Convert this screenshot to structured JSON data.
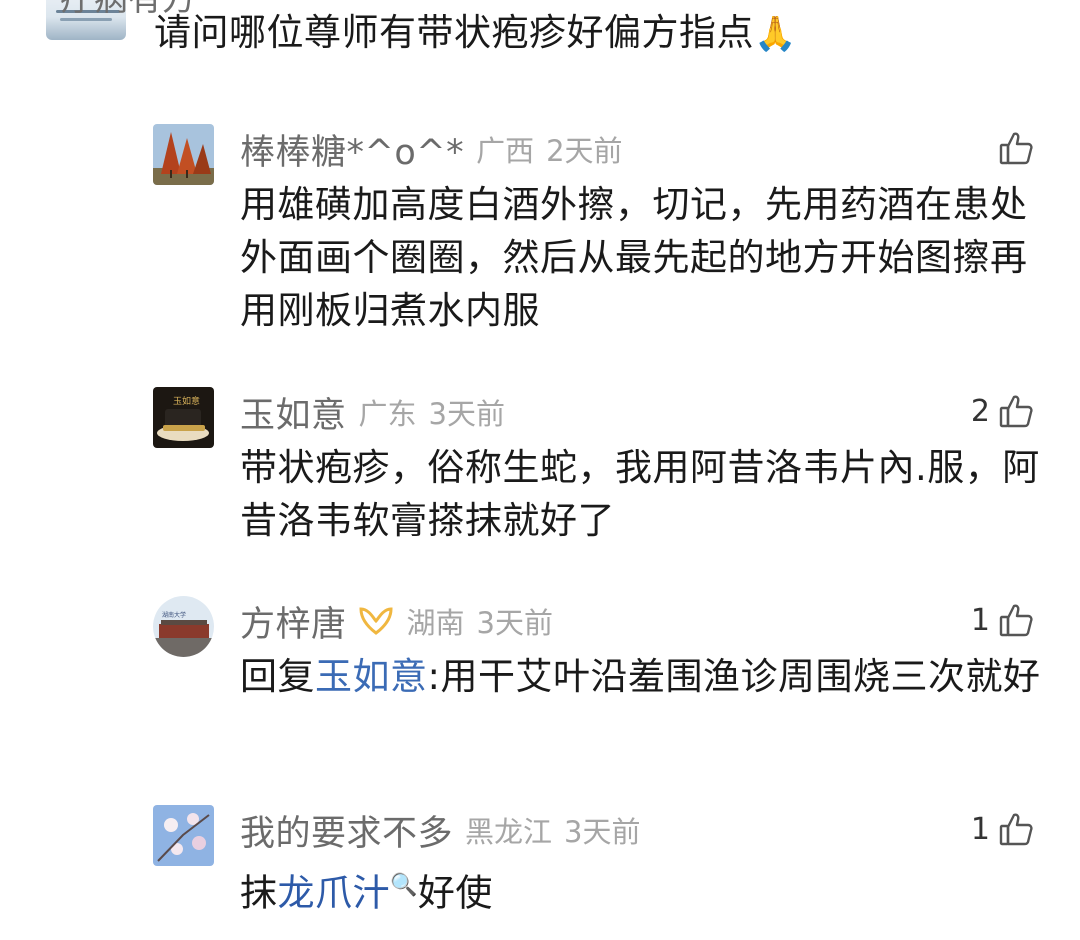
{
  "parent": {
    "username": "疗病有方",
    "text": "请问哪位尊师有带状疱疹好偏方指点",
    "emoji": "🙏"
  },
  "replies": [
    {
      "name": "棒棒糖*^o^*",
      "region": "广西",
      "time": "2天前",
      "likes": "",
      "body": "用雄磺加高度白酒外擦，切记，先用药酒在患处外面画个圈圈，然后从最先起的地方开始图擦再用刚板归煮水内服"
    },
    {
      "name": "玉如意",
      "region": "广东",
      "time": "3天前",
      "likes": "2",
      "body": "带状疱疹，俗称生蛇，我用阿昔洛韦片內.服，阿昔洛韦软膏搽抹就好了"
    },
    {
      "name": "方梓唐",
      "region": "湖南",
      "time": "3天前",
      "likes": "1",
      "body_prefix": "回复",
      "mention": "玉如意",
      "body": ":用干艾叶沿羞围渔诊周围烧三次就好"
    },
    {
      "name": "我的要求不多",
      "region": "黑龙江",
      "time": "3天前",
      "likes": "1",
      "body_prefix": "抹",
      "link_text": "龙爪汁",
      "link_icon": "🔍",
      "body": "好使"
    }
  ],
  "icons": {
    "like": "thumbs-up-icon",
    "vip": "vip-badge-icon"
  },
  "colors": {
    "name": "#6b6b6b",
    "meta": "#a6a6a6",
    "mention": "#3b6bb5",
    "link": "#2d5aa8"
  }
}
